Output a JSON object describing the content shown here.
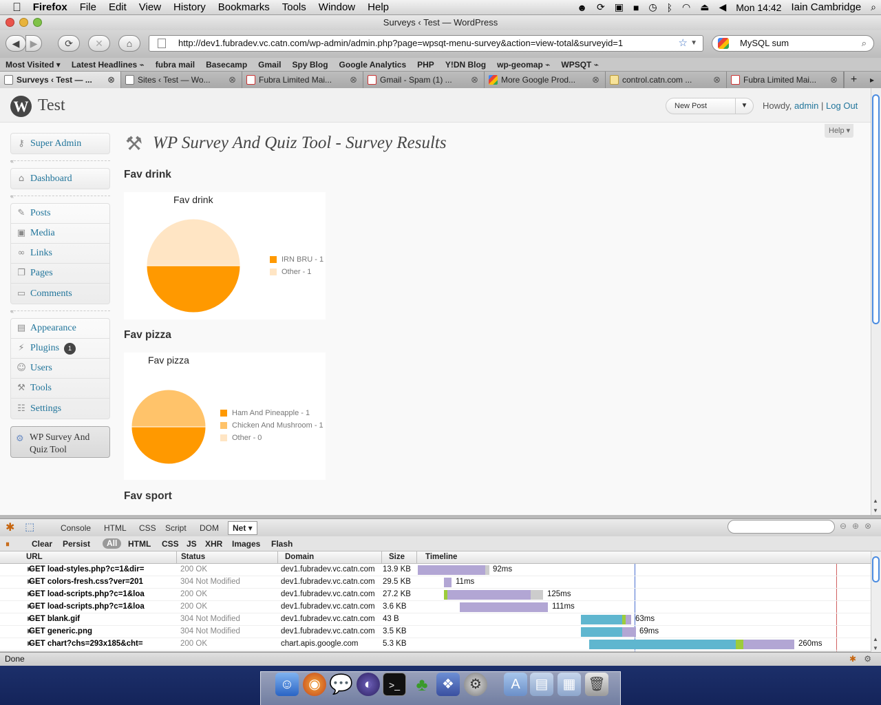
{
  "menubar": {
    "apple": "",
    "app": "Firefox",
    "items": [
      "File",
      "Edit",
      "View",
      "History",
      "Bookmarks",
      "Tools",
      "Window",
      "Help"
    ],
    "clock": "Mon 14:42",
    "user": "Iain Cambridge"
  },
  "window": {
    "title": "Surveys ‹ Test — WordPress"
  },
  "toolbar": {
    "url": "http://dev1.fubradev.vc.catn.com/wp-admin/admin.php?page=wpsqt-menu-survey&action=view-total&surveyid=1",
    "search": "MySQL sum"
  },
  "bookmarks": [
    "Most Visited ▾",
    "Latest Headlines ⌁",
    "fubra mail",
    "Basecamp",
    "Gmail",
    "Spy Blog",
    "Google Analytics",
    "PHP",
    "Y!DN Blog",
    "wp-geomap ⌁",
    "WPSQT ⌁"
  ],
  "tabs": [
    {
      "label": "Surveys ‹ Test — ..."
    },
    {
      "label": "Sites ‹ Test — Wo..."
    },
    {
      "label": "Fubra Limited Mai..."
    },
    {
      "label": "Gmail - Spam (1) ..."
    },
    {
      "label": "More Google Prod..."
    },
    {
      "label": "control.catn.com ..."
    },
    {
      "label": "Fubra Limited Mai..."
    }
  ],
  "wp": {
    "site_name": "Test",
    "new_post": "New Post",
    "howdy": "Howdy, ",
    "user": "admin",
    "separator": " | ",
    "logout": "Log Out",
    "help": "Help ▾",
    "menu": {
      "super_admin": "Super Admin",
      "dashboard": "Dashboard",
      "posts": "Posts",
      "media": "Media",
      "links": "Links",
      "pages": "Pages",
      "comments": "Comments",
      "appearance": "Appearance",
      "plugins": "Plugins",
      "plugins_badge": "1",
      "users": "Users",
      "tools": "Tools",
      "settings": "Settings",
      "wp_survey_line1": "WP Survey And",
      "wp_survey_line2": "Quiz Tool"
    },
    "page_title": "WP Survey And Quiz Tool - Survey Results",
    "questions": [
      {
        "title": "Fav drink"
      },
      {
        "title": "Fav pizza"
      },
      {
        "title": "Fav sport"
      }
    ]
  },
  "chart_data": [
    {
      "type": "pie",
      "title": "Fav drink",
      "categories": [
        "IRN BRU",
        "Other"
      ],
      "values": [
        1,
        1
      ],
      "legend": [
        "IRN BRU - 1",
        "Other - 1"
      ],
      "colors": [
        "#ff9900",
        "#ffe5c4"
      ]
    },
    {
      "type": "pie",
      "title": "Fav pizza",
      "categories": [
        "Ham And Pineapple",
        "Chicken And Mushroom",
        "Other"
      ],
      "values": [
        1,
        1,
        0
      ],
      "legend": [
        "Ham And Pineapple - 1",
        "Chicken And Mushroom - 1",
        "Other - 0"
      ],
      "colors": [
        "#ff9900",
        "#ffc36a",
        "#ffe5c4"
      ]
    }
  ],
  "firebug": {
    "tabs": [
      "Console",
      "HTML",
      "CSS",
      "Script",
      "DOM"
    ],
    "active_tab": "Net ▾",
    "sub": [
      "Clear",
      "Persist",
      "All",
      "HTML",
      "CSS",
      "JS",
      "XHR",
      "Images",
      "Flash"
    ],
    "headers": [
      "URL",
      "Status",
      "Domain",
      "Size",
      "Timeline"
    ],
    "rows": [
      {
        "url": "GET load-styles.php?c=1&dir=",
        "status": "200 OK",
        "domain": "dev1.fubradev.vc.catn.com",
        "size": "13.9 KB",
        "time": "92ms"
      },
      {
        "url": "GET colors-fresh.css?ver=201",
        "status": "304 Not Modified",
        "domain": "dev1.fubradev.vc.catn.com",
        "size": "29.5 KB",
        "time": "11ms"
      },
      {
        "url": "GET load-scripts.php?c=1&loa",
        "status": "200 OK",
        "domain": "dev1.fubradev.vc.catn.com",
        "size": "27.2 KB",
        "time": "125ms"
      },
      {
        "url": "GET load-scripts.php?c=1&loa",
        "status": "200 OK",
        "domain": "dev1.fubradev.vc.catn.com",
        "size": "3.6 KB",
        "time": "111ms"
      },
      {
        "url": "GET blank.gif",
        "status": "304 Not Modified",
        "domain": "dev1.fubradev.vc.catn.com",
        "size": "43 B",
        "time": "63ms"
      },
      {
        "url": "GET generic.png",
        "status": "304 Not Modified",
        "domain": "dev1.fubradev.vc.catn.com",
        "size": "3.5 KB",
        "time": "69ms"
      },
      {
        "url": "GET chart?chs=293x185&cht=",
        "status": "200 OK",
        "domain": "chart.apis.google.com",
        "size": "5.3 KB",
        "time": "260ms"
      }
    ]
  },
  "statusbar": "Done"
}
